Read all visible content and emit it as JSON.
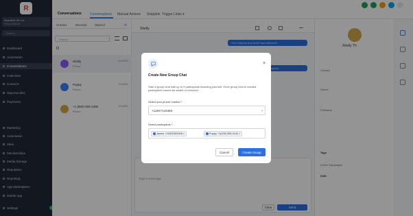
{
  "sidebar": {
    "logo": "R",
    "account_name": "Sweetest Ire Lrd",
    "account_sub": "Pery tuldstod",
    "search_placeholder": "Search",
    "items": [
      {
        "label": "Dashboard"
      },
      {
        "label": "Automation"
      },
      {
        "label": "Conversations"
      },
      {
        "label": "Calendars"
      },
      {
        "label": "Contacts"
      },
      {
        "label": "Opportunities"
      },
      {
        "label": "Payments"
      },
      {
        "label": "Marketing"
      },
      {
        "label": "Automation"
      },
      {
        "label": "Sites"
      },
      {
        "label": "Memberships"
      },
      {
        "label": "Media Storage"
      },
      {
        "label": "Reputation"
      },
      {
        "label": "Reporting"
      },
      {
        "label": "App Marketplace"
      },
      {
        "label": "Mobile App"
      }
    ],
    "settings": "Settings"
  },
  "topbar": {
    "tabs": [
      "Conversations",
      "Conversations",
      "Manual Actions",
      "Snippets",
      "Trigger Links ▾"
    ]
  },
  "list": {
    "tabs": [
      "Unread",
      "Recents",
      "Starred",
      "All"
    ],
    "search_placeholder": "Search",
    "rows": [
      {
        "name": "Shelly",
        "sub": "Phone",
        "date": "12/18/24"
      },
      {
        "name": "Puppy",
        "sub": "Phone",
        "date": "12/18/24"
      },
      {
        "name": "+1 (850) 555-2390",
        "sub": "Phone",
        "date": "12/18/24"
      }
    ]
  },
  "chat": {
    "contact": "Shelly",
    "bubbles": [
      "Your Keyrnet and order was delivered",
      "Please come back from the Instagram"
    ],
    "compose_placeholder": "Type a message",
    "clear": "Clear",
    "send": "Send"
  },
  "right": {
    "name": "Shelly Th",
    "sections": [
      "Contact",
      "Owner",
      "Followers",
      "Tags",
      "DND",
      "Active Campaigns"
    ]
  },
  "modal": {
    "title": "Create New Group Chat",
    "description": "Start a group chat with up to 9 participants including yourself. Once group chat is created, participants cannot be added or removed.",
    "from_label": "Select your phone number *",
    "from_value": "+12647143483",
    "participants_label": "Select participants *",
    "chips": [
      "James +16302353308",
      "Puppy +1(205) 555-0142"
    ],
    "cancel": "Cancel",
    "create": "Create Group"
  },
  "colors": {
    "accent": "#2f6fe0",
    "sidebar": "#1f2937"
  }
}
